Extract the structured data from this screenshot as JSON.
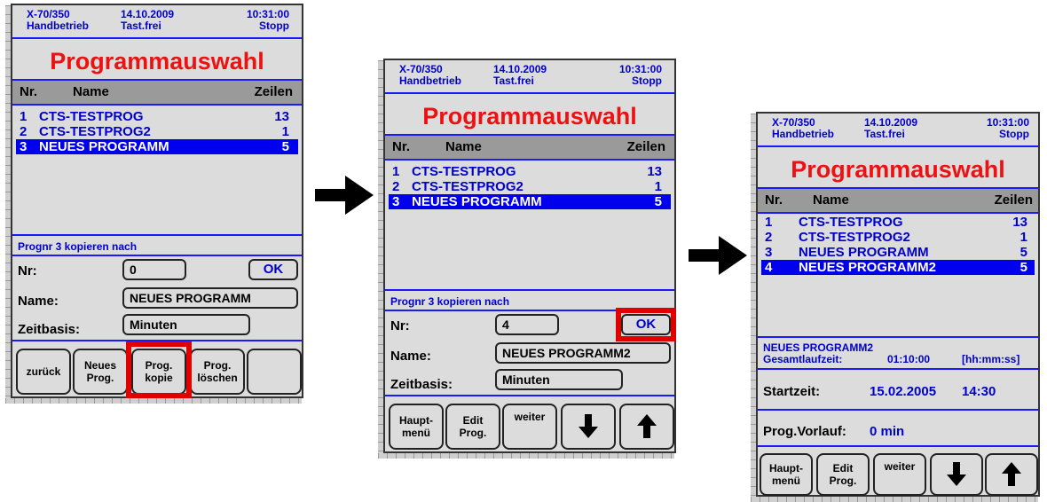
{
  "header": {
    "model": "X-70/350",
    "mode": "Handbetrieb",
    "date": "14.10.2009",
    "keys": "Tast.frei",
    "time": "10:31:00",
    "status": "Stopp"
  },
  "title": "Programmauswahl",
  "columns": {
    "nr": "Nr.",
    "name": "Name",
    "lines": "Zeilen"
  },
  "programs_a": [
    {
      "nr": "1",
      "name": "CTS-TESTPROG",
      "lines": "13"
    },
    {
      "nr": "2",
      "name": "CTS-TESTPROG2",
      "lines": "1"
    },
    {
      "nr": "3",
      "name": "NEUES PROGRAMM",
      "lines": "5"
    }
  ],
  "programs_b": [
    {
      "nr": "1",
      "name": "CTS-TESTPROG",
      "lines": "13"
    },
    {
      "nr": "2",
      "name": "CTS-TESTPROG2",
      "lines": "1"
    },
    {
      "nr": "3",
      "name": "NEUES PROGRAMM",
      "lines": "5"
    },
    {
      "nr": "4",
      "name": "NEUES PROGRAMM2",
      "lines": "5"
    }
  ],
  "copy": {
    "title": "Prognr 3 kopieren nach",
    "nr_label": "Nr:",
    "name_label": "Name:",
    "time_label": "Zeitbasis:",
    "ok": "OK"
  },
  "screen1": {
    "nr_value": "0",
    "name_value": "NEUES PROGRAMM",
    "time_value": "Minuten",
    "buttons": [
      "zurück",
      "Neues\nProg.",
      "Prog.\nkopie",
      "Prog.\nlöschen",
      ""
    ]
  },
  "screen2": {
    "nr_value": "4",
    "name_value": "NEUES PROGRAMM2",
    "time_value": "Minuten",
    "buttons": [
      "Haupt-\nmenü",
      "Edit\nProg.",
      "weiter",
      "down-arrow-icon",
      "up-arrow-icon"
    ]
  },
  "screen3": {
    "prog_name": "NEUES PROGRAMM2",
    "total_label": "Gesamtlaufzeit:",
    "total_value": "01:10:00",
    "total_unit": "[hh:mm:ss]",
    "start_label": "Startzeit:",
    "start_date": "15.02.2005",
    "start_time": "14:30",
    "lead_label": "Prog.Vorlauf:",
    "lead_value": "0 min",
    "buttons": [
      "Haupt-\nmenü",
      "Edit\nProg.",
      "weiter",
      "down-arrow-icon",
      "up-arrow-icon"
    ]
  },
  "colors": {
    "accent": "#0000cc",
    "title": "#ee1111",
    "highlight": "#e00000",
    "selection": "#0000ee"
  }
}
